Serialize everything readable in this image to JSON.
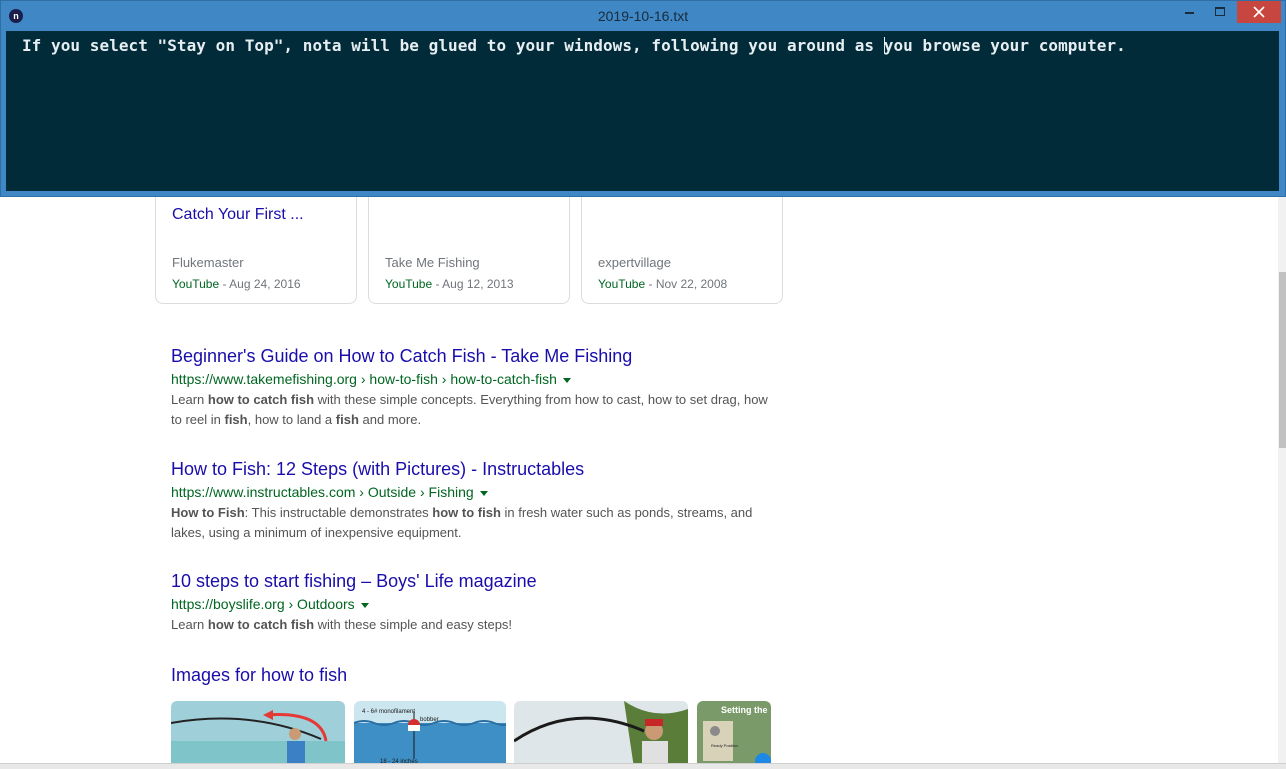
{
  "window": {
    "title": "2019-10-16.txt",
    "app_icon_letter": "n",
    "editor_text_before_caret": "If you select \"Stay on Top\", nota will be glued to your windows, following you around as ",
    "editor_text_after_caret": "you browse your computer."
  },
  "videos": [
    {
      "title": "Catch Your First ...",
      "channel": "Flukemaster",
      "source": "YouTube",
      "date": " - Aug 24, 2016"
    },
    {
      "title": "",
      "channel": "Take Me Fishing",
      "source": "YouTube",
      "date": " - Aug 12, 2013"
    },
    {
      "title": "",
      "channel": "expertvillage",
      "source": "YouTube",
      "date": " - Nov 22, 2008"
    }
  ],
  "results": [
    {
      "title": "Beginner's Guide on How to Catch Fish - Take Me Fishing",
      "url": "https://www.takemefishing.org › how-to-fish › how-to-catch-fish",
      "snippet": [
        {
          "t": "Learn ",
          "b": false
        },
        {
          "t": "how to catch fish",
          "b": true
        },
        {
          "t": " with these simple concepts. Everything from how to cast, how to set drag, how to reel in ",
          "b": false
        },
        {
          "t": "fish",
          "b": true
        },
        {
          "t": ", how to land a ",
          "b": false
        },
        {
          "t": "fish",
          "b": true
        },
        {
          "t": " and more.",
          "b": false
        }
      ]
    },
    {
      "title": "How to Fish: 12 Steps (with Pictures) - Instructables",
      "url": "https://www.instructables.com › Outside › Fishing",
      "snippet": [
        {
          "t": "How to Fish",
          "b": true
        },
        {
          "t": ": This instructable demonstrates ",
          "b": false
        },
        {
          "t": "how to fish",
          "b": true
        },
        {
          "t": " in fresh water such as ponds, streams, and lakes, using a minimum of inexpensive equipment.",
          "b": false
        }
      ]
    },
    {
      "title": "10 steps to start fishing – Boys' Life magazine",
      "url": "https://boyslife.org › Outdoors",
      "snippet": [
        {
          "t": "Learn ",
          "b": false
        },
        {
          "t": "how to catch fish",
          "b": true
        },
        {
          "t": " with these simple and easy steps!",
          "b": false
        }
      ]
    }
  ],
  "images_section": {
    "title": "Images for how to fish",
    "thumb2_labels": [
      "4 - 6# monofilament",
      "bobber",
      "18 - 24 inches"
    ],
    "thumb4_label": "Setting the",
    "thumb4_sublabel": "Ready Position"
  },
  "colors": {
    "title_bar": "#3f88c5",
    "editor_bg": "#022b3a",
    "close_btn": "#c7463f",
    "link": "#1a0dab",
    "url_green": "#006621"
  }
}
